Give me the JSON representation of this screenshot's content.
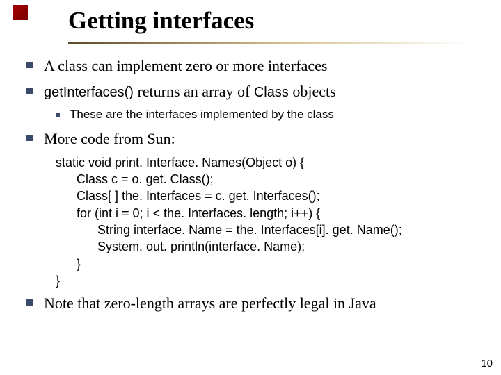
{
  "title": "Getting interfaces",
  "bullets": {
    "b1": "A class can implement zero or more interfaces",
    "b2_pre": "getInterfaces()",
    "b2_mid": " returns an array of ",
    "b2_code2": "Class",
    "b2_post": " objects",
    "b2_sub": "These are the interfaces implemented by the class",
    "b3": "More code from Sun:",
    "b4": "Note that zero-length arrays are perfectly legal in Java"
  },
  "code": "static void print. Interface. Names(Object o) {\n      Class c = o. get. Class();\n      Class[ ] the. Interfaces = c. get. Interfaces();\n      for (int i = 0; i < the. Interfaces. length; i++) {\n            String interface. Name = the. Interfaces[i]. get. Name();\n            System. out. println(interface. Name);\n      }\n}",
  "page_number": "10"
}
